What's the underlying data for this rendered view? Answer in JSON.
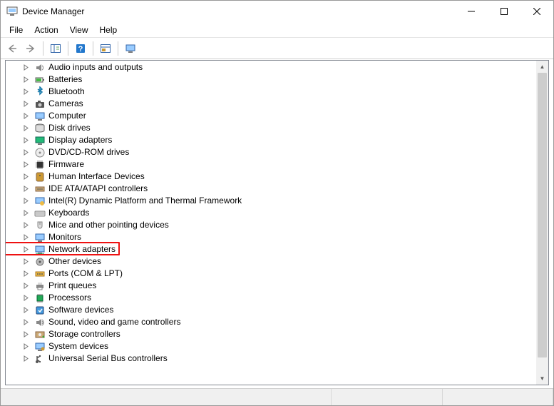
{
  "window": {
    "title": "Device Manager"
  },
  "menu": {
    "file": "File",
    "action": "Action",
    "view": "View",
    "help": "Help"
  },
  "devices": [
    {
      "label": "Audio inputs and outputs",
      "icon": "speaker"
    },
    {
      "label": "Batteries",
      "icon": "battery"
    },
    {
      "label": "Bluetooth",
      "icon": "bluetooth"
    },
    {
      "label": "Cameras",
      "icon": "camera"
    },
    {
      "label": "Computer",
      "icon": "monitor"
    },
    {
      "label": "Disk drives",
      "icon": "disk"
    },
    {
      "label": "Display adapters",
      "icon": "display"
    },
    {
      "label": "DVD/CD-ROM drives",
      "icon": "optical"
    },
    {
      "label": "Firmware",
      "icon": "chip"
    },
    {
      "label": "Human Interface Devices",
      "icon": "hid"
    },
    {
      "label": "IDE ATA/ATAPI controllers",
      "icon": "ide"
    },
    {
      "label": "Intel(R) Dynamic Platform and Thermal Framework",
      "icon": "thermal"
    },
    {
      "label": "Keyboards",
      "icon": "keyboard"
    },
    {
      "label": "Mice and other pointing devices",
      "icon": "mouse"
    },
    {
      "label": "Monitors",
      "icon": "monitor"
    },
    {
      "label": "Network adapters",
      "icon": "network",
      "highlight": true
    },
    {
      "label": "Other devices",
      "icon": "other"
    },
    {
      "label": "Ports (COM & LPT)",
      "icon": "port"
    },
    {
      "label": "Print queues",
      "icon": "printer"
    },
    {
      "label": "Processors",
      "icon": "cpu"
    },
    {
      "label": "Software devices",
      "icon": "software"
    },
    {
      "label": "Sound, video and game controllers",
      "icon": "sound"
    },
    {
      "label": "Storage controllers",
      "icon": "storage"
    },
    {
      "label": "System devices",
      "icon": "system"
    },
    {
      "label": "Universal Serial Bus controllers",
      "icon": "usb"
    }
  ]
}
